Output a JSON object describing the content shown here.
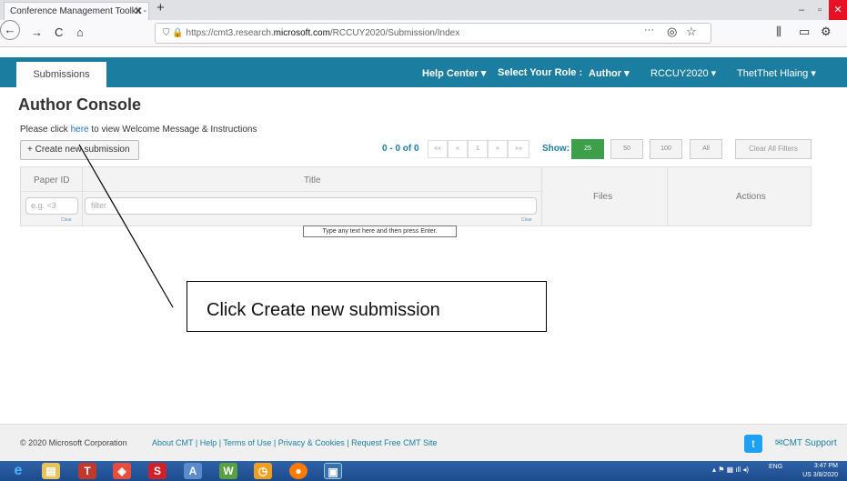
{
  "browser": {
    "tab_title": "Conference Management Toolkit -",
    "url_prefix": "https://cmt3.research.",
    "url_domain": "microsoft.com",
    "url_path": "/RCCUY2020/Submission/Index",
    "more": "···"
  },
  "header": {
    "submissions_tab": "Submissions",
    "help_center": "Help Center ▾",
    "select_role": "Select Your Role :",
    "role": "Author ▾",
    "conference": "RCCUY2020 ▾",
    "user": "ThetThet Hlaing ▾"
  },
  "console": {
    "title": "Author Console",
    "welcome_prefix": "Please click ",
    "welcome_link": "here",
    "welcome_suffix": " to view Welcome Message & Instructions",
    "create_button": "+ Create new submission",
    "count": "0 - 0 of 0",
    "pager": [
      "««",
      "«",
      "1",
      "»",
      "»»"
    ],
    "show_label": "Show:",
    "page_sizes": [
      "25",
      "50",
      "100",
      "All"
    ],
    "active_size": "25",
    "clear_all": "Clear All Filters"
  },
  "table": {
    "columns": [
      "Paper ID",
      "Title",
      "Files",
      "Actions"
    ],
    "paper_id_placeholder": "e.g. <3",
    "title_placeholder": "filter",
    "clear": "Clear",
    "tooltip": "Type any text here and then press Enter."
  },
  "annotation": {
    "callout": "Click Create new submission"
  },
  "footer": {
    "copyright": "© 2020 Microsoft Corporation",
    "links": "About CMT | Help | Terms of Use | Privacy & Cookies | Request Free CMT Site",
    "support": "✉CMT Support"
  },
  "taskbar": {
    "lang": "ENG",
    "time": "3:47 PM",
    "date": "US   3/8/2020"
  }
}
